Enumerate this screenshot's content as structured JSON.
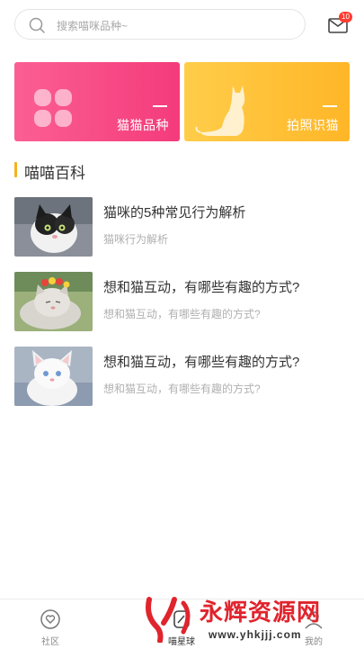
{
  "search": {
    "placeholder": "搜索喵咪品种~"
  },
  "header": {
    "mail_badge": "10"
  },
  "banners": [
    {
      "label": "猫猫品种",
      "icon": "clover-icon",
      "color": "#f43b7b"
    },
    {
      "label": "拍照识猫",
      "icon": "cat-silhouette-icon",
      "color": "#ffb627"
    }
  ],
  "section": {
    "title": "喵喵百科",
    "accent": "#f6b21b"
  },
  "articles": [
    {
      "title": "猫咪的5种常见行为解析",
      "subtitle": "猫咪行为解析"
    },
    {
      "title": "想和猫互动，有哪些有趣的方式?",
      "subtitle": "想和猫互动，有哪些有趣的方式?"
    },
    {
      "title": "想和猫互动，有哪些有趣的方式?",
      "subtitle": "想和猫互动，有哪些有趣的方式?"
    }
  ],
  "tabs": [
    {
      "label": "社区",
      "icon": "heart-bubble-icon"
    },
    {
      "label": "喵星球",
      "icon": "cat-planet-icon"
    },
    {
      "label": "我的",
      "icon": "profile-icon"
    }
  ],
  "watermark": {
    "text": "永辉资源网",
    "url": "www.yhkjjj.com"
  }
}
